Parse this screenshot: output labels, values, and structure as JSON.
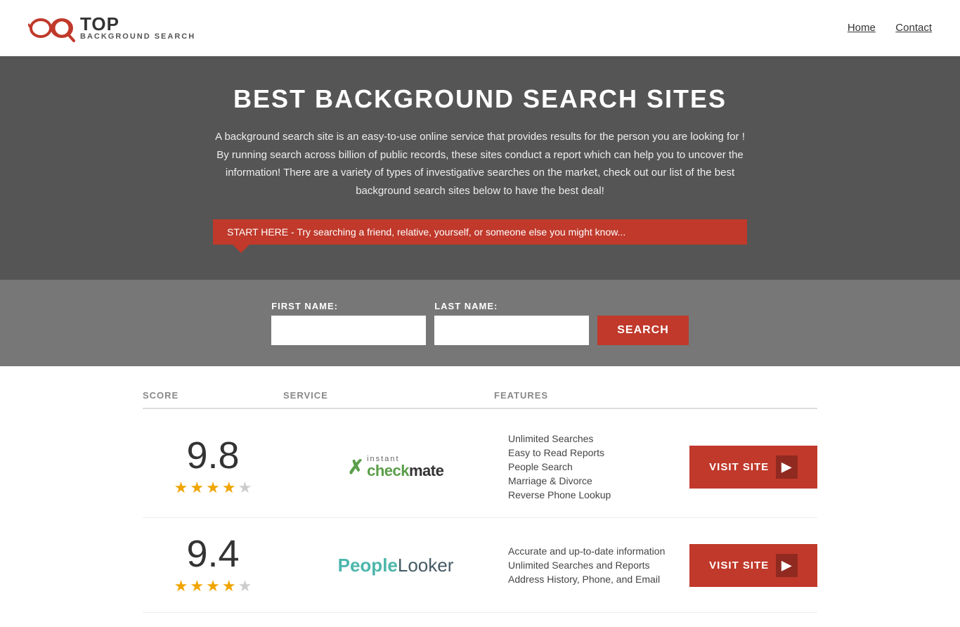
{
  "header": {
    "logo_top": "TOP",
    "logo_sub": "BACKGROUND SEARCH",
    "nav": [
      {
        "label": "Home",
        "href": "#"
      },
      {
        "label": "Contact",
        "href": "#"
      }
    ]
  },
  "hero": {
    "title": "BEST BACKGROUND SEARCH SITES",
    "description": "A background search site is an easy-to-use online service that provides results  for the person you are looking for ! By  running  search across billion of public records, these sites conduct  a report which can help you to uncover the information! There are a variety of types of investigative searches on the market, check out our  list of the best background search sites below to have the best deal!",
    "banner_text": "START HERE - Try searching a friend, relative, yourself, or someone else you might know...",
    "form": {
      "first_name_label": "FIRST NAME:",
      "last_name_label": "LAST NAME:",
      "search_button": "SEARCH"
    }
  },
  "table": {
    "headers": {
      "score": "SCORE",
      "service": "SERVICE",
      "features": "FEATURES"
    },
    "rows": [
      {
        "score": "9.8",
        "stars": 4,
        "service_name": "Instant Checkmate",
        "features": [
          "Unlimited Searches",
          "Easy to Read Reports",
          "People Search",
          "Marriage & Divorce",
          "Reverse Phone Lookup"
        ],
        "visit_label": "VISIT SITE"
      },
      {
        "score": "9.4",
        "stars": 4,
        "service_name": "PeopleLooker",
        "features": [
          "Accurate and up-to-date information",
          "Unlimited Searches and Reports",
          "Address History, Phone, and Email"
        ],
        "visit_label": "VISIT SITE"
      }
    ]
  }
}
